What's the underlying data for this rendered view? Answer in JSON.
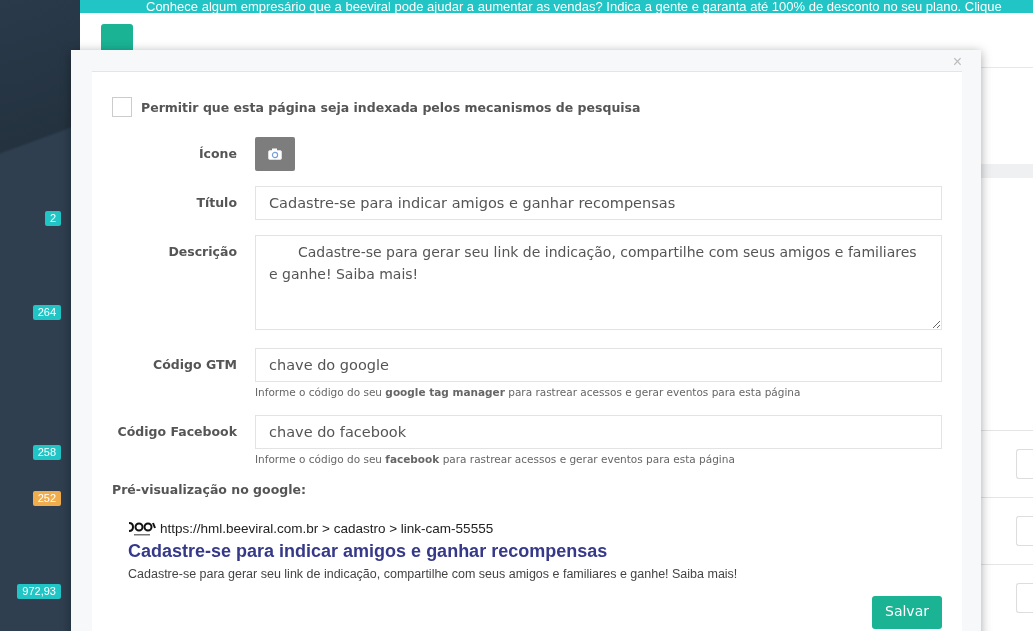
{
  "banner": {
    "text": "Conhece algum empresário que a beeviral pode ajudar a aumentar as vendas? Indica a gente e garanta até 100% de desconto no seu plano. Clique"
  },
  "sidebar": {
    "badges": [
      {
        "value": "2",
        "color": "#22c5c5"
      },
      {
        "value": "264",
        "color": "#22c5c5"
      },
      {
        "value": "258",
        "color": "#22c5c5"
      },
      {
        "value": "252",
        "color": "#f0ad4e"
      },
      {
        "value": "972,93",
        "color": "#22c5c5"
      }
    ]
  },
  "modal": {
    "close": "×",
    "index_checkbox": {
      "label": "Permitir que esta página seja indexada pelos mecanismos de pesquisa",
      "checked": false
    },
    "fields": [
      {
        "kind": "icon",
        "label": "Ícone"
      },
      {
        "kind": "input",
        "label": "Título",
        "value": "Cadastre-se para indicar amigos e ganhar recompensas"
      },
      {
        "kind": "textarea",
        "label": "Descrição",
        "value": "Cadastre-se para gerar seu link de indicação, compartilhe com seus amigos e familiares e ganhe! Saiba mais!"
      },
      {
        "kind": "input",
        "label": "Código GTM",
        "value": "chave do google",
        "help": "Informe o código do seu **google tag manager** para rastrear acessos e gerar eventos para esta página"
      },
      {
        "kind": "input",
        "label": "Código Facebook",
        "value": "chave do facebook",
        "help": "Informe o código do seu **facebook** para rastrear acessos e gerar eventos para esta página"
      }
    ],
    "preview": {
      "heading": "Pré-visualização no google:",
      "url": "https://hml.beeviral.com.br > cadastro > link-cam-55555",
      "title": "Cadastre-se para indicar amigos e ganhar recompensas",
      "description": "Cadastre-se para gerar seu link de indicação, compartilhe com seus amigos e familiares e ganhe! Saiba mais!"
    },
    "save_button": "Salvar"
  }
}
